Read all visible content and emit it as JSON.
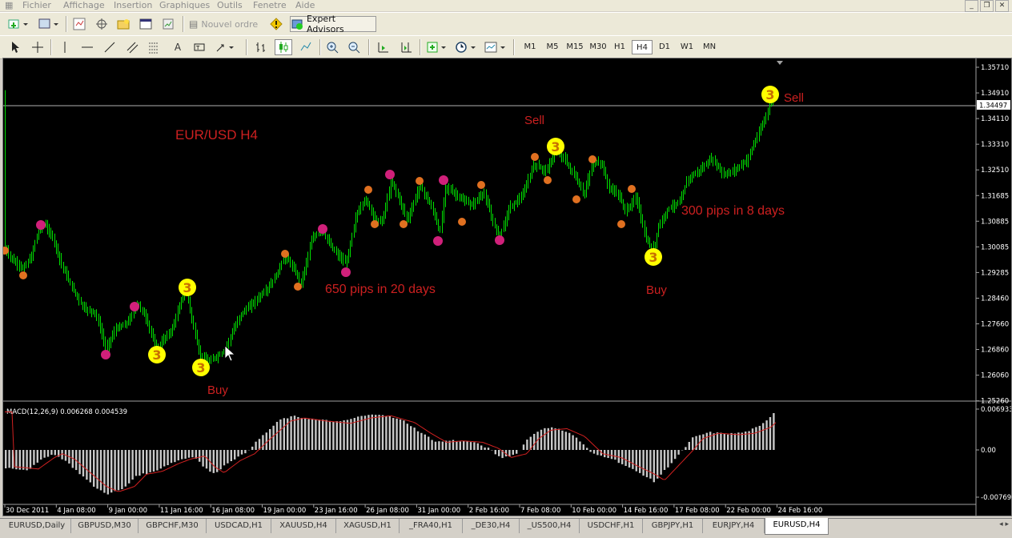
{
  "menu": [
    "Fichier",
    "Affichage",
    "Insertion",
    "Graphiques",
    "Outils",
    "Fenetre",
    "Aide"
  ],
  "toolbar": {
    "new_order": "Nouvel ordre",
    "expert_advisors": "Expert Advisors"
  },
  "timeframes": [
    "M1",
    "M5",
    "M15",
    "M30",
    "H1",
    "H4",
    "D1",
    "W1",
    "MN"
  ],
  "active_timeframe": "H4",
  "chart": {
    "title": "EUR/USD  H4",
    "current_price": "1.34497",
    "price_ticks": [
      "1.35710",
      "1.34910",
      "1.34110",
      "1.33310",
      "1.32510",
      "1.31685",
      "1.30885",
      "1.30085",
      "1.29285",
      "1.28460",
      "1.27660",
      "1.26860",
      "1.26060",
      "1.25260"
    ],
    "annotations": {
      "sell1": "Sell",
      "sell2": "Sell",
      "buy1": "Buy",
      "buy2": "Buy",
      "pips1": "650 pips in 20 days",
      "pips2": "300 pips in 8 days",
      "signal": "3"
    },
    "date_ticks": [
      "30 Dec 2011",
      "4 Jan 08:00",
      "9 Jan 00:00",
      "11 Jan 16:00",
      "16 Jan 08:00",
      "19 Jan 00:00",
      "23 Jan 16:00",
      "26 Jan 08:00",
      "31 Jan 00:00",
      "2 Feb 16:00",
      "7 Feb 08:00",
      "10 Feb 00:00",
      "14 Feb 16:00",
      "17 Feb 08:00",
      "22 Feb 00:00",
      "24 Feb 16:00"
    ],
    "colors": {
      "background": "#000000",
      "candles": "#00e000",
      "text": "#cc2020",
      "macd_signal": "#cc2020",
      "macd_hist": "#c0c0c0",
      "marker_yellow": "#ffff00",
      "marker_magenta": "#d0207a",
      "marker_orange": "#e07020"
    }
  },
  "macd": {
    "label": "MACD(12,26,9) 0.006268 0.004539",
    "ticks": [
      "0.006933",
      "0.00",
      "-0.00769"
    ]
  },
  "symbol_tabs": [
    "EURUSD,Daily",
    "GBPUSD,M30",
    "GBPCHF,M30",
    "USDCAD,H1",
    "XAUUSD,H4",
    "XAGUSD,H1",
    "_FRA40,H1",
    "_DE30,H4",
    "_US500,H4",
    "USDCHF,H1",
    "GBPJPY,H1",
    "EURJPY,H4",
    "EURUSD,H4"
  ],
  "active_tab": "EURUSD,H4"
}
